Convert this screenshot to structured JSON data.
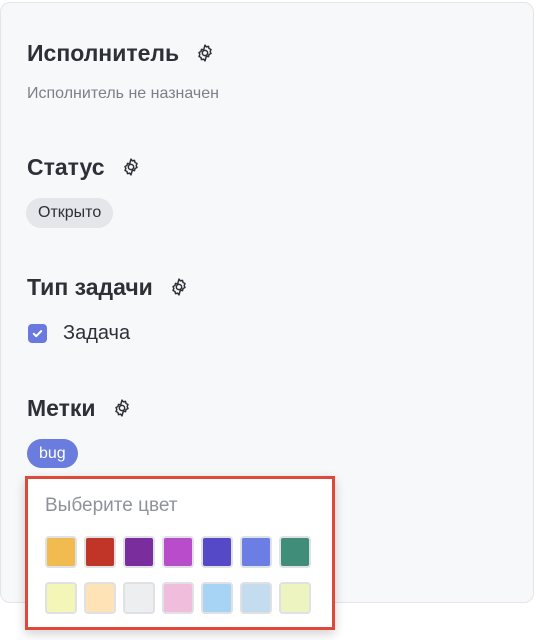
{
  "assignee": {
    "title": "Исполнитель",
    "settings_icon": "gear-icon",
    "empty_text": "Исполнитель не назначен"
  },
  "status": {
    "title": "Статус",
    "settings_icon": "gear-icon",
    "value": "Открыто"
  },
  "issue_type": {
    "title": "Тип задачи",
    "settings_icon": "gear-icon",
    "value": "Задача",
    "checked": true
  },
  "labels": {
    "title": "Метки",
    "settings_icon": "gear-icon",
    "tags": [
      "bug"
    ],
    "tag_color": "#6a7cde"
  },
  "color_picker": {
    "title": "Выберите цвет",
    "border_color": "#e0493a",
    "swatches_row1": [
      "#f2bb50",
      "#c13428",
      "#7a2e9e",
      "#b84ccb",
      "#5549c7",
      "#6a7ee3",
      "#408d7a"
    ],
    "swatches_row2": [
      "#f4f6b8",
      "#fde3b6",
      "#eceef0",
      "#f0bddc",
      "#a7d3f5",
      "#c3ddef",
      "#eef4c0"
    ]
  }
}
